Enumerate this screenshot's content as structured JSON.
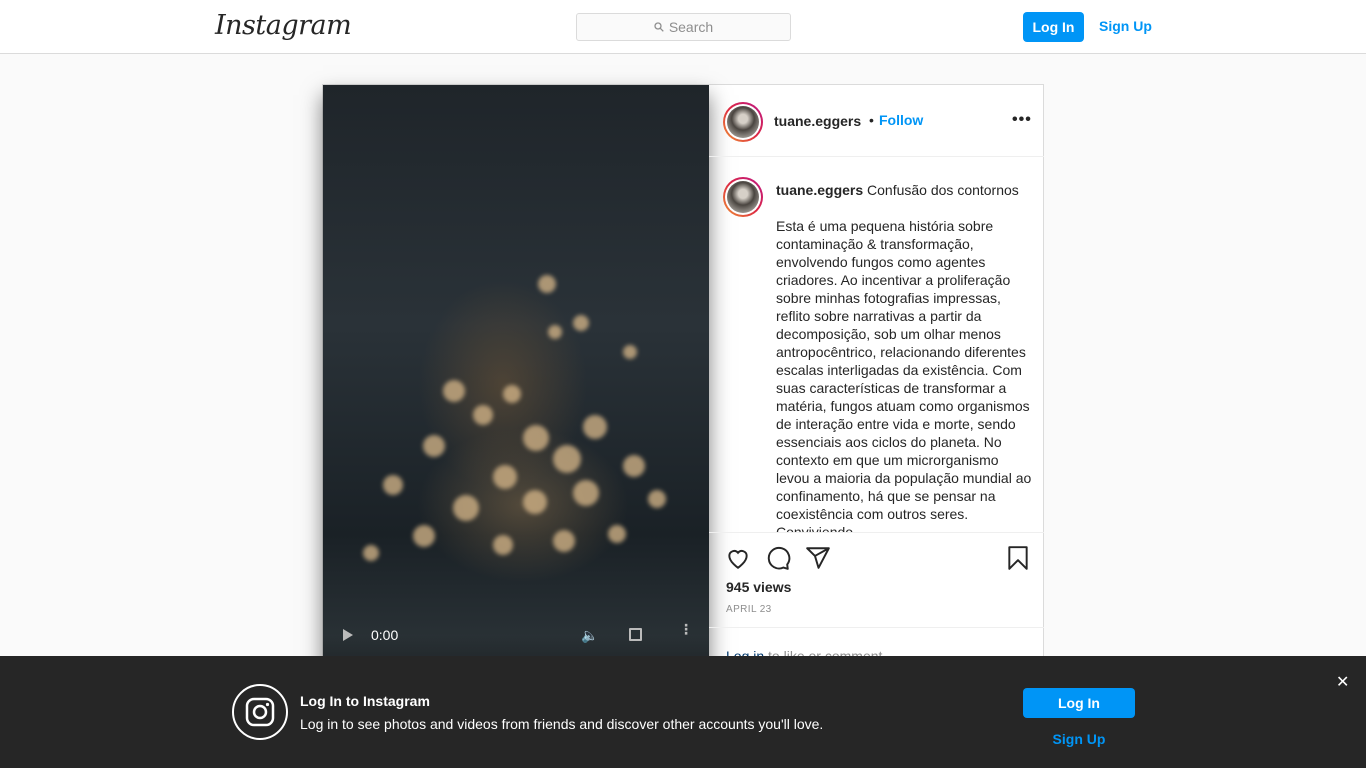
{
  "nav": {
    "logo": "Instagram",
    "search_placeholder": "Search",
    "login_label": "Log In",
    "signup_label": "Sign Up"
  },
  "post": {
    "username": "tuane.eggers",
    "separator": "•",
    "follow_label": "Follow",
    "more_label": "•••",
    "caption_title": "Confusão dos contornos",
    "caption_body": "Esta é uma pequena história sobre contaminação & transformação, envolvendo fungos como agentes criadores. Ao incentivar a proliferação sobre minhas fotografias impressas, reflito sobre narrativas a partir da decomposição, sob um olhar menos antropocêntrico, relacionando diferentes escalas interligadas da existência. Com suas características de transformar a matéria, fungos atuam como organismos de interação entre vida e morte, sendo essenciais aos ciclos do planeta. No contexto em que um microrganismo levou a maioria da população mundial ao confinamento, há que se pensar na coexistência com outros seres. Conviviendo",
    "views": "945 views",
    "date": "APRIL 23",
    "comment_login_link": "Log in",
    "comment_login_rest": " to like or comment."
  },
  "video": {
    "time": "0:00",
    "more": "⋮",
    "volume": "🔈"
  },
  "banner": {
    "title": "Log In to Instagram",
    "text": "Log in to see photos and videos from friends and discover other accounts you'll love.",
    "login_label": "Log In",
    "signup_label": "Sign Up",
    "close_label": "✕"
  },
  "colors": {
    "accent": "#0095f6",
    "banner_bg": "#262626"
  }
}
